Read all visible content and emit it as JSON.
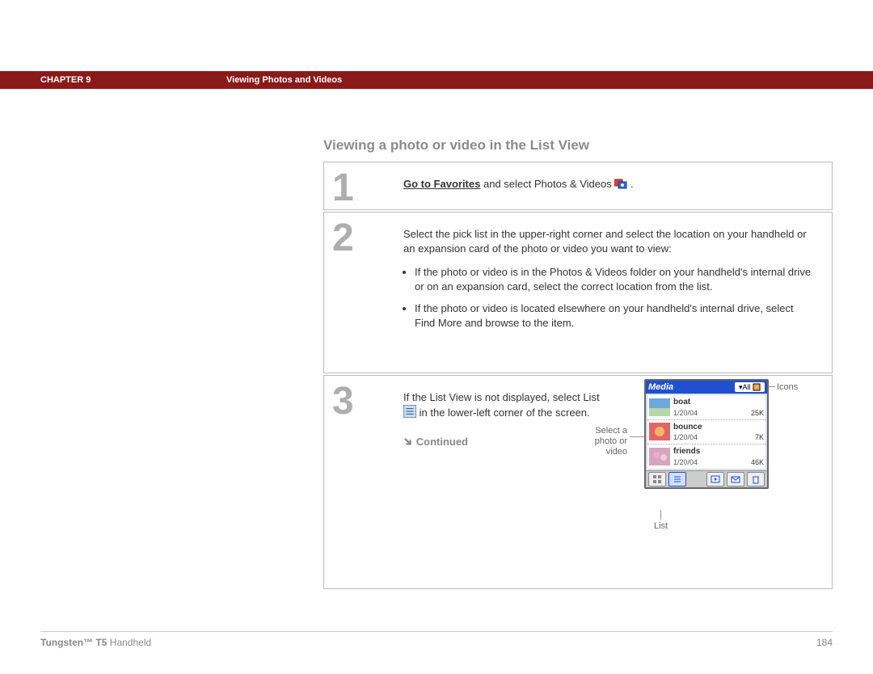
{
  "header": {
    "chapter": "CHAPTER 9",
    "section": "Viewing Photos and Videos"
  },
  "title": "Viewing a photo or video in the List View",
  "steps": {
    "s1": {
      "num": "1",
      "link": "Go to Favorites",
      "text": " and select Photos & Videos "
    },
    "s2": {
      "num": "2",
      "intro": "Select the pick list in the upper-right corner and select the location on your handheld or an expansion card of the photo or video you want to view:",
      "b1": "If the photo or video is in the Photos & Videos folder on your handheld's internal drive or on an expansion card, select the correct location from the list.",
      "b2": "If the photo or video is located elsewhere on your handheld's internal drive, select Find More and browse to the item."
    },
    "s3": {
      "num": "3",
      "text1": "If the List View is not displayed, select List ",
      "text2": " in the lower-left corner of the screen.",
      "continued": "Continued"
    }
  },
  "callouts": {
    "left": "Select a photo or video",
    "right": "Icons",
    "bottom": "List"
  },
  "device": {
    "title": "Media",
    "filter": "All",
    "rows": [
      {
        "name": "boat",
        "date": "1/20/04",
        "size": "25K",
        "colors": [
          "#6fa8dc",
          "#b6d7a8"
        ]
      },
      {
        "name": "bounce",
        "date": "1/20/04",
        "size": "7K",
        "colors": [
          "#e06666",
          "#f6b26b"
        ]
      },
      {
        "name": "friends",
        "date": "1/20/04",
        "size": "46K",
        "colors": [
          "#d5a6bd",
          "#b4a7d6"
        ]
      }
    ]
  },
  "footer": {
    "product_bold": "Tungsten™ T5",
    "product_light": " Handheld",
    "page": "184"
  }
}
